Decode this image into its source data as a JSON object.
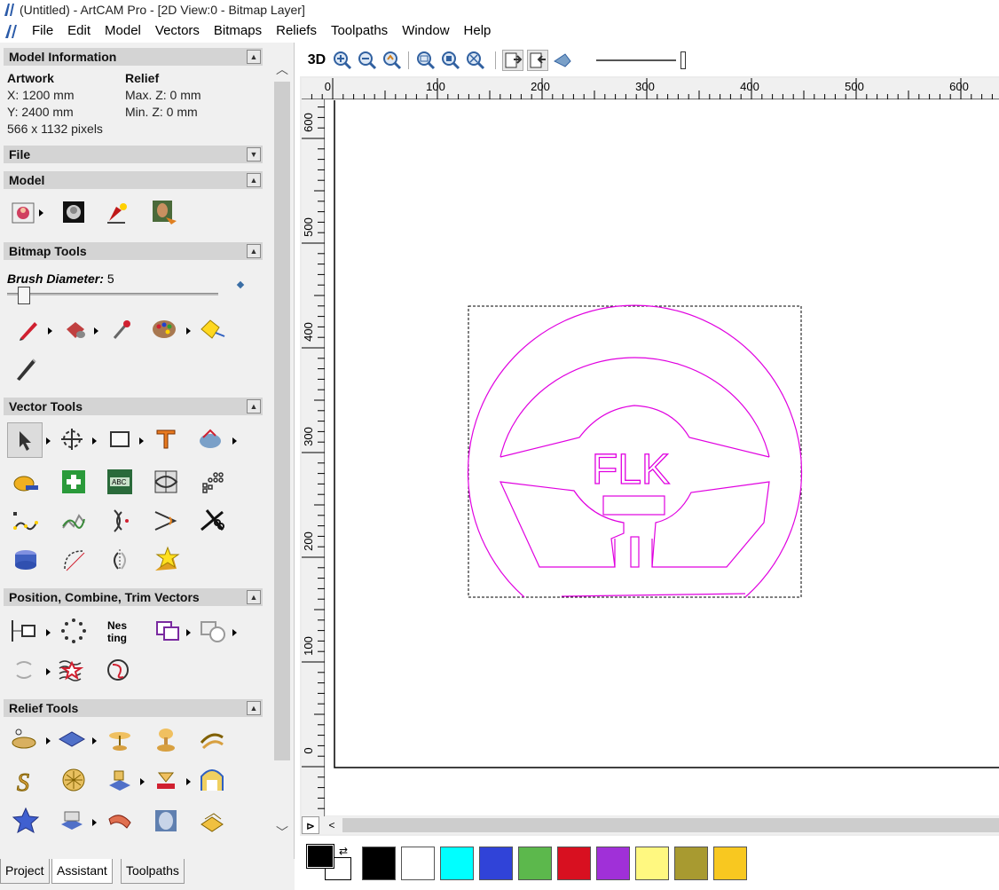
{
  "window": {
    "title": "(Untitled) - ArtCAM Pro - [2D View:0 - Bitmap Layer]"
  },
  "menu": [
    "File",
    "Edit",
    "Model",
    "Vectors",
    "Bitmaps",
    "Reliefs",
    "Toolpaths",
    "Window",
    "Help"
  ],
  "left_panel": {
    "model_info": {
      "header": "Model Information",
      "artwork_label": "Artwork",
      "relief_label": "Relief",
      "x": "X: 1200 mm",
      "y": "Y: 2400 mm",
      "pixels": "566 x 1132 pixels",
      "max_z": "Max. Z: 0 mm",
      "min_z": "Min. Z: 0 mm"
    },
    "sections": {
      "file": "File",
      "model": "Model",
      "bitmap_tools": "Bitmap Tools",
      "vector_tools": "Vector Tools",
      "position": "Position, Combine, Trim Vectors",
      "relief_tools": "Relief Tools"
    },
    "brush": {
      "label": "Brush Diameter:",
      "value": "5",
      "slider_fraction": 0.05
    }
  },
  "tabs": {
    "project": "Project",
    "assistant": "Assistant",
    "toolpaths": "Toolpaths"
  },
  "view_toolbar": {
    "mode_3d": "3D",
    "zoom_slider_fraction": 0.95
  },
  "rulers": {
    "horizontal": [
      "0",
      "100",
      "200",
      "300",
      "400",
      "500",
      "600"
    ],
    "vertical": [
      "600",
      "500",
      "400",
      "300",
      "200",
      "100",
      "0"
    ]
  },
  "drawing": {
    "text": "FLK",
    "stroke_color": "#e000e0"
  },
  "palette": {
    "foreground": "#000000",
    "background": "#ffffff",
    "colors": [
      "#000000",
      "#ffffff",
      "#00ffff",
      "#3043d8",
      "#5cb84c",
      "#d81020",
      "#a030d8",
      "#fff880",
      "#a89a30",
      "#f8c820"
    ]
  }
}
